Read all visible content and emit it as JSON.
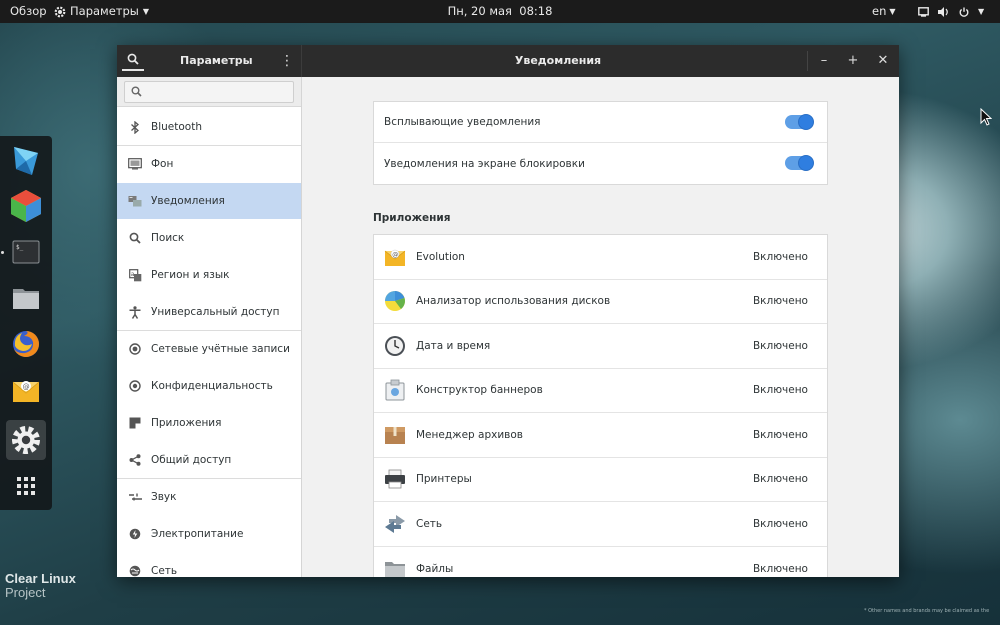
{
  "topbar": {
    "activities": "Обзор",
    "app_menu": "Параметры",
    "clock": "Пн, 20 мая  08:18",
    "language": "en"
  },
  "window": {
    "sidebar_title": "Параметры",
    "page_title": "Уведомления",
    "search_placeholder": ""
  },
  "sidebar": {
    "items": [
      {
        "label": "Bluetooth",
        "icon": "bluetooth-icon"
      },
      {
        "label": "Фон",
        "icon": "background-icon"
      },
      {
        "label": "Уведомления",
        "icon": "notifications-icon",
        "selected": true
      },
      {
        "label": "Поиск",
        "icon": "search-icon"
      },
      {
        "label": "Регион и язык",
        "icon": "region-icon"
      },
      {
        "label": "Универсальный доступ",
        "icon": "accessibility-icon"
      },
      {
        "label": "Сетевые учётные записи",
        "icon": "online-accounts-icon"
      },
      {
        "label": "Конфиденциальность",
        "icon": "privacy-icon"
      },
      {
        "label": "Приложения",
        "icon": "applications-icon"
      },
      {
        "label": "Общий доступ",
        "icon": "sharing-icon"
      },
      {
        "label": "Звук",
        "icon": "sound-icon"
      },
      {
        "label": "Электропитание",
        "icon": "power-icon"
      },
      {
        "label": "Сеть",
        "icon": "network-icon"
      }
    ]
  },
  "notifications": {
    "popup_label": "Всплывающие уведомления",
    "popup_enabled": true,
    "lock_label": "Уведомления на экране блокировки",
    "lock_enabled": true
  },
  "apps": {
    "heading": "Приложения",
    "items": [
      {
        "name": "Evolution",
        "state": "Включено",
        "icon": "evolution-icon"
      },
      {
        "name": "Анализатор использования дисков",
        "state": "Включено",
        "icon": "disk-usage-icon"
      },
      {
        "name": "Дата и время",
        "state": "Включено",
        "icon": "clock-icon"
      },
      {
        "name": "Конструктор баннеров",
        "state": "Включено",
        "icon": "banner-icon"
      },
      {
        "name": "Менеджер архивов",
        "state": "Включено",
        "icon": "archive-icon"
      },
      {
        "name": "Принтеры",
        "state": "Включено",
        "icon": "printer-icon"
      },
      {
        "name": "Сеть",
        "state": "Включено",
        "icon": "network-icon"
      },
      {
        "name": "Файлы",
        "state": "Включено",
        "icon": "files-icon"
      }
    ]
  },
  "brand": {
    "line1": "Clear Linux",
    "line2": "Project",
    "footnote": "* Other names and brands may be claimed as the"
  },
  "colors": {
    "accent": "#2f7ee0",
    "selection": "#c4d8f2",
    "topbar": "#1b1b1b",
    "headerbar": "#2c2c2c"
  }
}
